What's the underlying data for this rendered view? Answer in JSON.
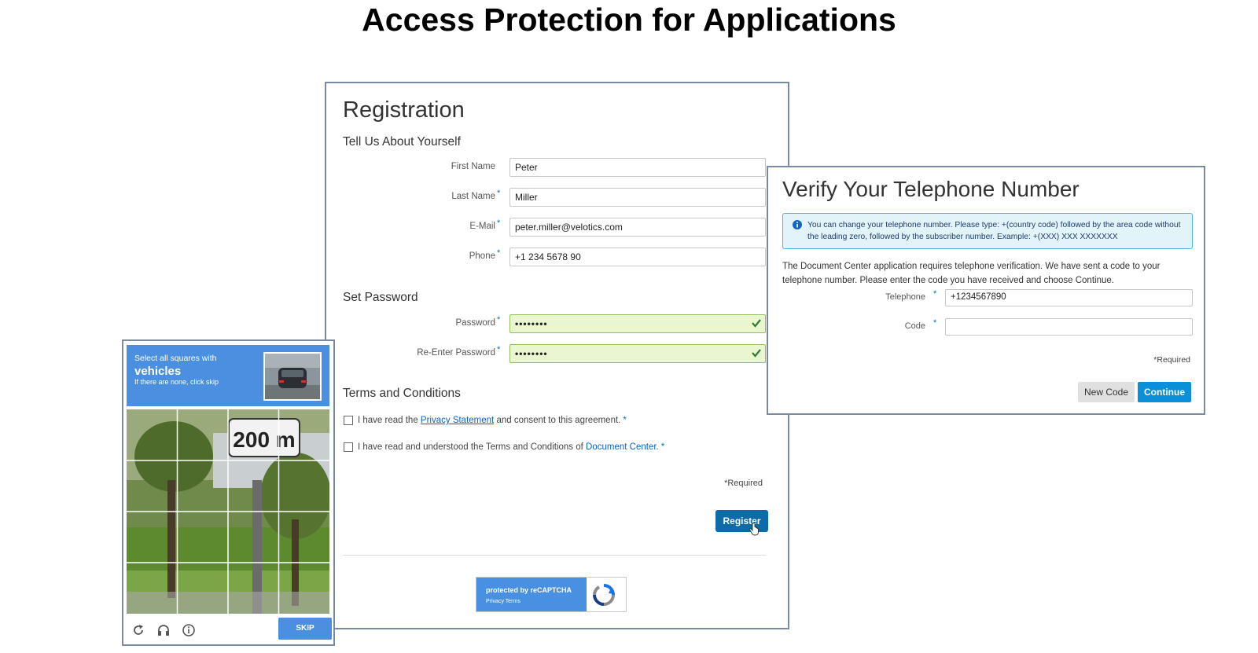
{
  "page_title": "Access Protection for Applications",
  "registration": {
    "title": "Registration",
    "section_about": "Tell Us About Yourself",
    "fields": [
      {
        "label": "First Name",
        "value": "Peter",
        "required": false
      },
      {
        "label": "Last Name",
        "value": "Miller",
        "required": true
      },
      {
        "label": "E-Mail",
        "value": "peter.miller@velotics.com",
        "required": true
      },
      {
        "label": "Phone",
        "value": "+1 234 5678 90",
        "required": true
      }
    ],
    "section_password": "Set Password",
    "password_fields": [
      {
        "label": "Password",
        "value": "••••••••",
        "required": true,
        "valid": true
      },
      {
        "label": "Re-Enter Password",
        "value": "••••••••",
        "required": true,
        "valid": true
      }
    ],
    "section_terms": "Terms and Conditions",
    "terms": {
      "privacy_prefix": "I have read the ",
      "privacy_link": "Privacy Statement",
      "privacy_suffix": " and consent to this agreement.",
      "tc_prefix": "I have read and understood the Terms and Conditions of ",
      "tc_link": "Document Center.",
      "star": "*"
    },
    "required_note": "*Required",
    "register_button": "Register",
    "recaptcha": {
      "protected_by": "protected by reCAPTCHA",
      "links": "Privacy  Terms"
    }
  },
  "verify": {
    "title": "Verify Your Telephone Number",
    "info_message": "You can change your telephone number. Please type: +(country code) followed by the area code without the leading zero, followed by the subscriber number. Example: +(XXX) XXX XXXXXXX",
    "description": "The Document Center application requires telephone verification. We have sent a code to your telephone number. Please enter the code you have received and choose Continue.",
    "telephone_label": "Telephone",
    "telephone_value": "+1234567890",
    "code_label": "Code",
    "code_value": "",
    "star": "*",
    "required_note": "*Required",
    "new_code_button": "New Code",
    "continue_button": "Continue"
  },
  "captcha": {
    "instruction_line1": "Select all squares with",
    "instruction_target": "vehicles",
    "instruction_line3": "If there are none, click skip",
    "sign_text": "200 m",
    "skip_button": "SKIP",
    "icons": [
      "reload-icon",
      "headphones-icon",
      "info-icon"
    ],
    "header_color": "#4a8fe0"
  },
  "colors": {
    "primary_button": "#0e6ba8",
    "continue_button": "#0a8fd8",
    "valid_field": "#e9f6cf",
    "info_box": "#e3f3fa",
    "link": "#0a64c2"
  }
}
